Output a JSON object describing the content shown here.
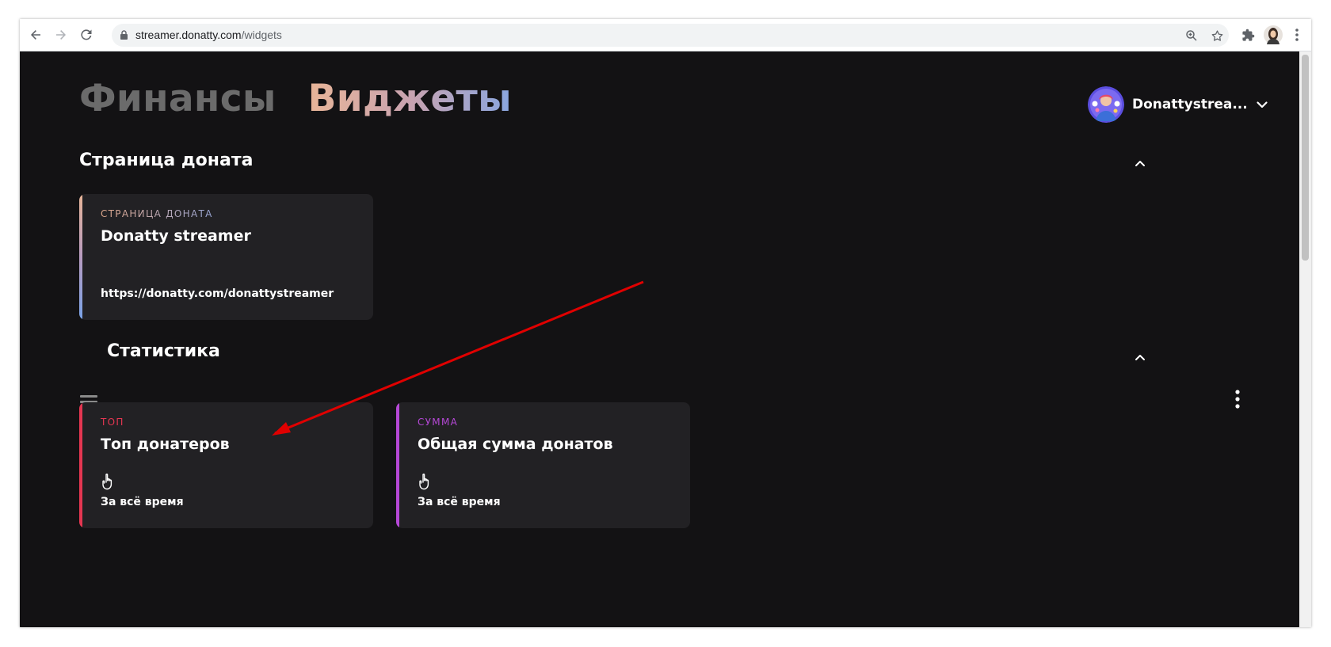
{
  "browser": {
    "url_host": "streamer.donatty.com",
    "url_path": "/widgets",
    "icons": [
      "back-icon",
      "forward-icon",
      "reload-icon",
      "lock-icon",
      "zoom-icon",
      "star-icon",
      "extensions-icon",
      "profile-avatar",
      "more-vert-icon"
    ]
  },
  "header": {
    "tabs": [
      {
        "label": "Финансы",
        "active": false
      },
      {
        "label": "Виджеты",
        "active": true
      }
    ],
    "profile_name": "Donattystrea..."
  },
  "sections": {
    "donate_page": {
      "title": "Страница доната",
      "card": {
        "kicker": "СТРАНИЦА ДОНАТА",
        "title": "Donatty streamer",
        "footer": "https://donatty.com/donattystreamer",
        "kicker_color": "#d8a58d"
      }
    },
    "statistics": {
      "title": "Статистика",
      "cards": [
        {
          "kicker": "ТОП",
          "title": "Топ донатеров",
          "footer": "За всё время",
          "accent": "#e53651",
          "icon": "hand-pointer-icon"
        },
        {
          "kicker": "СУММА",
          "title": "Общая сумма донатов",
          "footer": "За всё время",
          "accent": "#b548d6",
          "icon": "hand-pointer-icon"
        }
      ]
    }
  },
  "colors": {
    "page_bg": "#131214",
    "card_bg": "#222124",
    "annotation_arrow": "#e00000"
  }
}
